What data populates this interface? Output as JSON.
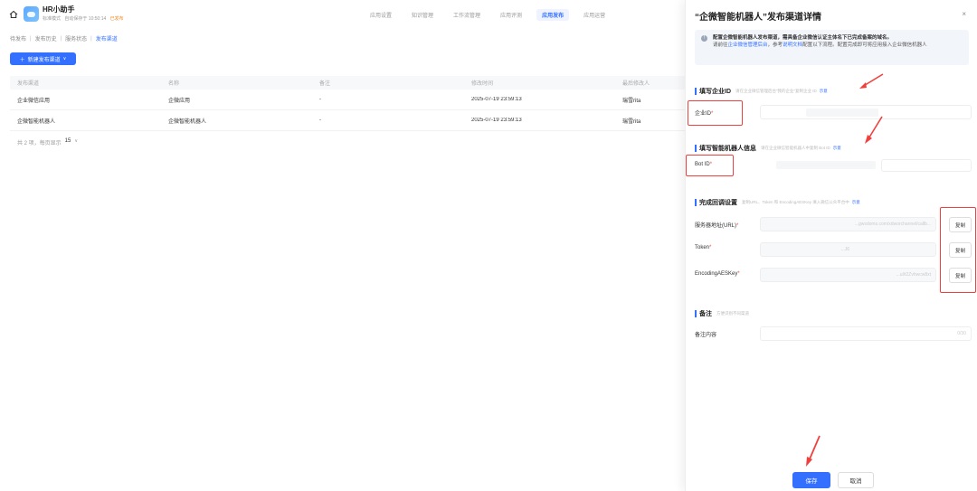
{
  "app": {
    "name": "HR小助手",
    "mode": "标准模式",
    "saved": "自动保存于 10:50:14",
    "tag": "已发布"
  },
  "top_nav": [
    "应用设置",
    "知识管理",
    "工作流管理",
    "应用评测",
    "应用发布",
    "应用运营"
  ],
  "top_nav_active": 4,
  "breadcrumb": [
    "待发布",
    "发布历史",
    "服务状态",
    "发布渠道"
  ],
  "new_button": "新建发布渠道",
  "table": {
    "headers": [
      "发布渠道",
      "名称",
      "备注",
      "修改时间",
      "最后修改人"
    ],
    "rows": [
      [
        "企业微信应用",
        "企微应用",
        "-",
        "2025-07-19 23:59:13",
        "瑞雪rita"
      ],
      [
        "企微智能机器人",
        "企微智能机器人",
        "-",
        "2025-07-19 23:59:13",
        "瑞雪rita"
      ]
    ]
  },
  "pager": {
    "total": "共 2 项，每页显示",
    "size": "15"
  },
  "drawer": {
    "title": "“企微智能机器人”发布渠道详情",
    "close": "×",
    "notice_line1": "配置企微智能机器人发布渠道，需具备企业微信认证主体名下已完成备案的域名。",
    "notice_line2_pre": "请前往",
    "notice_link1": "企业微信管理后台",
    "notice_line2_mid": "，参考",
    "notice_link2": "说明文档",
    "notice_line2_post": "配置以下流程。配置完成即可将应用接入企业微信机器人",
    "section1": {
      "title": "填写企业ID",
      "hint": "请在企业微信管理后台“我的企业”复制企业 ID",
      "link": "示意"
    },
    "corp_id_label": "企业ID",
    "section2": {
      "title": "填写智能机器人信息",
      "hint": "请在企业微信智能机器人中复制 Bot ID",
      "link": "示意"
    },
    "bot_id_label": "Bot ID",
    "section3": {
      "title": "完成回调设置",
      "hint": "复制URL、Token 和 EncodingAESKey 填入微信公众平台中",
      "link": "示意"
    },
    "server_url_label": "服务器地址(URL)",
    "server_url_value": "...gwsdoms.com/xdworchannel/callb...",
    "token_label": "Token",
    "token_value": "...J6",
    "aes_label": "EncodingAESKey",
    "aes_value": "...ul/t2Zvhwcw8xt",
    "copy": "复制",
    "section4": {
      "title": "备注",
      "hint": "方便识别不同渠道"
    },
    "remark_label": "备注内容",
    "remark_placeholder": "",
    "remark_count": "0/30",
    "save": "保存",
    "cancel": "取消"
  }
}
